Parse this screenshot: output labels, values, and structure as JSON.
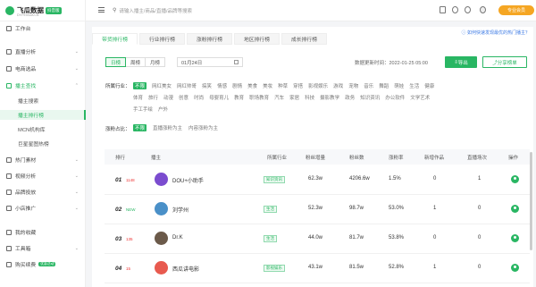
{
  "brand": {
    "name": "飞瓜数据",
    "badge": "抖音版",
    "sub": "DY.FEIGUA.CN"
  },
  "topbar": {
    "search_placeholder": "请输入播主/商品/直播/品牌等搜索",
    "pro_label": "专业会员"
  },
  "sidebar": {
    "items": [
      {
        "label": "工作台"
      },
      {
        "label": "直播分析"
      },
      {
        "label": "电商选品"
      },
      {
        "label": "播主查找"
      },
      {
        "label": "播主搜索"
      },
      {
        "label": "播主排行榜"
      },
      {
        "label": "MCN机构库"
      },
      {
        "label": "巨星星图热榜"
      },
      {
        "label": "热门素材"
      },
      {
        "label": "视频分析"
      },
      {
        "label": "品牌投放"
      },
      {
        "label": "小店推广"
      },
      {
        "label": "我的收藏"
      },
      {
        "label": "工具箱"
      },
      {
        "label": "购买续费",
        "tag": "优惠活动"
      }
    ]
  },
  "tabs": [
    "带货排行榜",
    "行业排行榜",
    "涨粉排行榜",
    "地区排行榜",
    "成长排行榜"
  ],
  "help_link": "如何快速发现最优的热门播主？",
  "period": {
    "options": [
      "日榜",
      "周榜",
      "月榜"
    ],
    "selected": "日榜",
    "date": "01月24日"
  },
  "update_time": "数据更新时间：2022-01-25 05:00",
  "export_label": "导出",
  "share_label": "分享榜单",
  "industry": {
    "label": "所属行业：",
    "rows": [
      [
        "不限",
        "网红美女",
        "网红帅哥",
        "搞笑",
        "情感",
        "剧情",
        "美食",
        "美妆",
        "种草",
        "穿搭",
        "影视娱乐",
        "游戏",
        "宠物",
        "音乐",
        "舞蹈",
        "萌娃",
        "生活",
        "健康"
      ],
      [
        "体育",
        "旅行",
        "动漫",
        "创意",
        "时尚",
        "母婴育儿",
        "教育",
        "职场教育",
        "汽车",
        "家居",
        "科技",
        "摄影教学",
        "政务",
        "知识资讯",
        "办公软件",
        "文学艺术"
      ],
      [
        "手工手绘",
        "户外"
      ]
    ],
    "selected": "不限"
  },
  "ratio": {
    "label": "涨粉占比：",
    "options": [
      "不限",
      "直播涨粉为主",
      "内容涨粉为主"
    ],
    "selected": "不限"
  },
  "table": {
    "headers": [
      "排行",
      "播主",
      "所属行业",
      "粉丝增量",
      "粉丝数",
      "涨粉率",
      "新增作品",
      "直播场次",
      "操作"
    ],
    "rows": [
      {
        "rank": "01",
        "change": "1148",
        "change_new": false,
        "name": "DOU+小助手",
        "industry": "知识资讯",
        "fan_inc": "62.3w",
        "fans": "4206.6w",
        "rate": "1.5%",
        "works": "0",
        "lives": "1",
        "avatar_color": "#7b4ccf"
      },
      {
        "rank": "02",
        "change": "NEW",
        "change_new": true,
        "name": "刘学州",
        "industry": "生活",
        "fan_inc": "52.3w",
        "fans": "98.7w",
        "rate": "53.0%",
        "works": "1",
        "lives": "0",
        "avatar_color": "#4a90c8"
      },
      {
        "rank": "03",
        "change": "135",
        "change_new": false,
        "name": "Dr.K",
        "industry": "生活",
        "fan_inc": "44.0w",
        "fans": "81.7w",
        "rate": "53.8%",
        "works": "0",
        "lives": "0",
        "avatar_color": "#6b5a4a"
      },
      {
        "rank": "04",
        "change": "15",
        "change_new": false,
        "name": "西瓜讲电影",
        "industry": "影视娱乐",
        "fan_inc": "43.1w",
        "fans": "81.5w",
        "rate": "52.8%",
        "works": "1",
        "lives": "0",
        "avatar_color": "#e85a4f"
      }
    ]
  }
}
